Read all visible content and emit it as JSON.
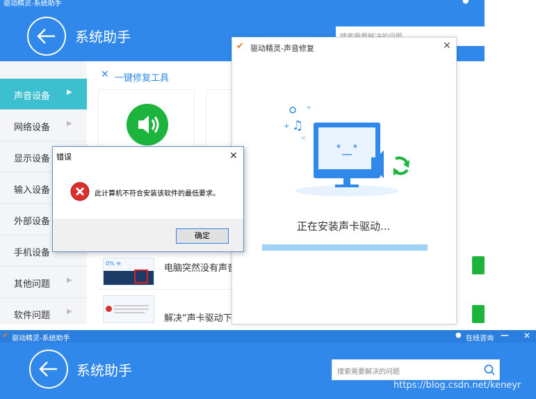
{
  "top_window": {
    "titlebar_title": "驱动精灵-系统助手",
    "header_title": "系统助手",
    "search_placeholder": "搜索需要解决的问题",
    "repair_tools_title": "一键修复工具",
    "sidebar_items": [
      {
        "label": "声音设备"
      },
      {
        "label": "网络设备"
      },
      {
        "label": "显示设备"
      },
      {
        "label": "输入设备"
      },
      {
        "label": "外部设备"
      },
      {
        "label": "手机设备"
      },
      {
        "label": "其他问题"
      },
      {
        "label": "软件问题"
      }
    ],
    "problems": [
      {
        "title": "电脑突然没有声音"
      },
      {
        "title": "解决“声卡驱动下"
      }
    ]
  },
  "repair_dialog": {
    "title": "驱动精灵-声音修复",
    "status": "正在安装声卡驱动...",
    "progress": 1.0
  },
  "error_dialog": {
    "title": "错误",
    "message": "此计算机不符合安装该软件的最低要求。",
    "ok_label": "确定"
  },
  "bottom_window": {
    "titlebar_title": "驱动精灵-系统助手",
    "online_consult": "在线咨询",
    "header_title": "系统助手",
    "search_placeholder": "搜索需要解决的问题"
  },
  "watermark": "https://blog.csdn.net/keneyr",
  "colors": {
    "header_blue": "#2f88ea",
    "active_cyan": "#3cc0d0",
    "green": "#1db43d",
    "error_red": "#d9302c"
  }
}
